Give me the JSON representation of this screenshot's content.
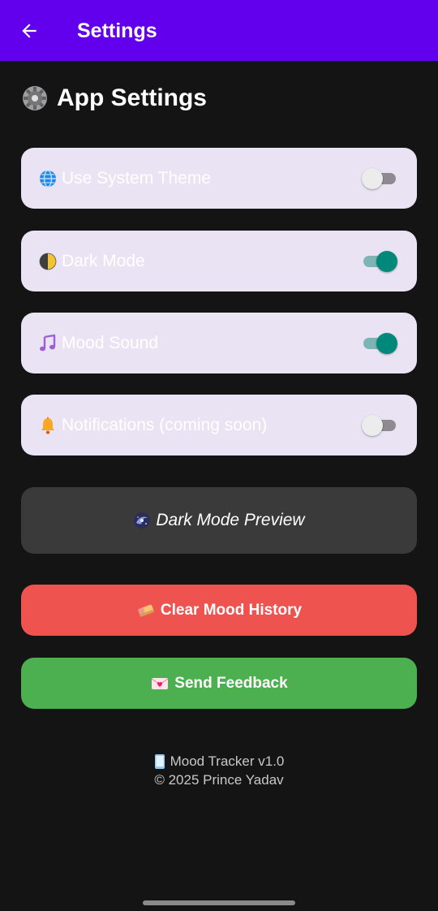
{
  "appbar": {
    "title": "Settings",
    "back_icon": "arrow-left-icon",
    "color": "#6200EE"
  },
  "section": {
    "title": "App Settings",
    "icon": "gear-icon"
  },
  "settings": [
    {
      "label": "Use System Theme",
      "icon": "globe-icon",
      "enabled": false
    },
    {
      "label": "Dark Mode",
      "icon": "half-moon-icon",
      "enabled": true
    },
    {
      "label": "Mood Sound",
      "icon": "music-note-icon",
      "enabled": true
    },
    {
      "label": "Notifications (coming soon)",
      "icon": "bell-icon",
      "enabled": false
    }
  ],
  "preview": {
    "label": "Dark Mode Preview",
    "icon": "galaxy-icon"
  },
  "buttons": {
    "clear_label": "Clear Mood History",
    "clear_icon": "eraser-icon",
    "clear_color": "#EF5350",
    "feedback_label": "Send Feedback",
    "feedback_icon": "love-letter-icon",
    "feedback_color": "#4CAF50"
  },
  "footer": {
    "line1": "Mood Tracker v1.0",
    "line1_icon": "phone-icon",
    "line2": "© 2025 Prince Yadav"
  },
  "colors": {
    "background": "#141414",
    "card": "#EAE3F4",
    "toggle_on": "#00897B"
  }
}
